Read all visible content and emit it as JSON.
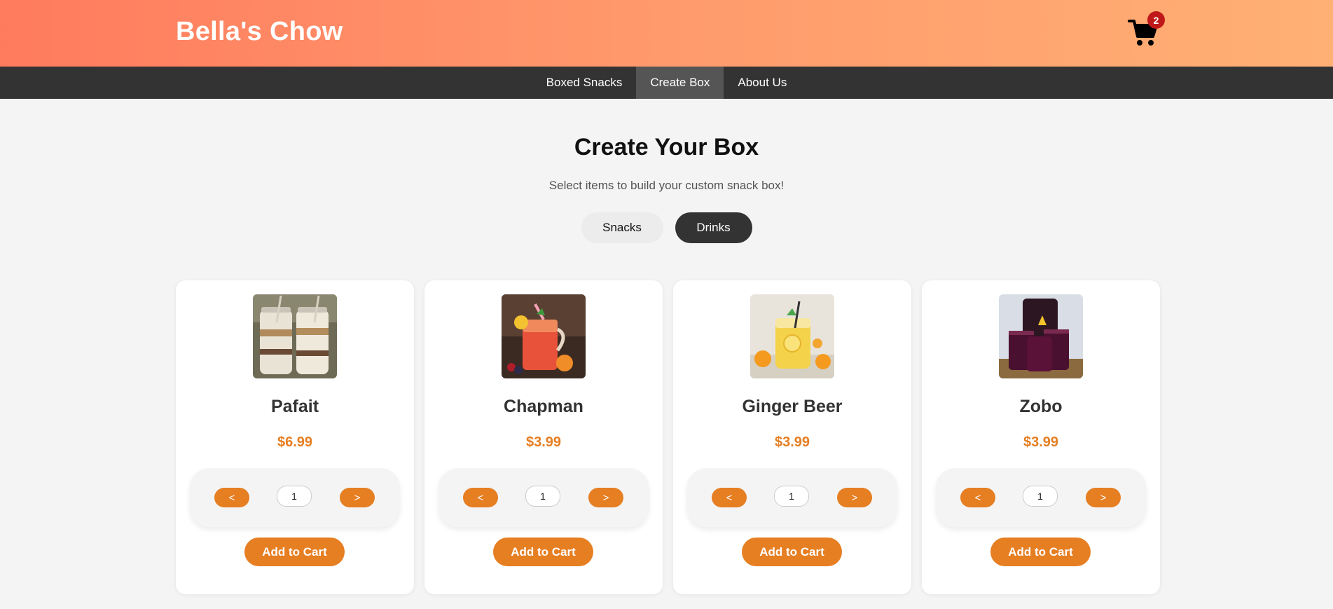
{
  "header": {
    "brand": "Bella's Chow",
    "cart_count": "2",
    "cart_icon": "shopping-cart-icon"
  },
  "nav": {
    "items": [
      {
        "label": "Boxed Snacks",
        "active": false
      },
      {
        "label": "Create Box",
        "active": true
      },
      {
        "label": "About Us",
        "active": false
      }
    ]
  },
  "main": {
    "title": "Create Your Box",
    "subtitle": "Select items to build your custom snack box!",
    "toggles": {
      "snacks": "Snacks",
      "drinks": "Drinks",
      "active": "Drinks"
    },
    "items": [
      {
        "name": "Pafait",
        "price": "$6.99",
        "qty": "1",
        "dec_label": "<",
        "inc_label": ">",
        "add_label": "Add to Cart"
      },
      {
        "name": "Chapman",
        "price": "$3.99",
        "qty": "1",
        "dec_label": "<",
        "inc_label": ">",
        "add_label": "Add to Cart"
      },
      {
        "name": "Ginger Beer",
        "price": "$3.99",
        "qty": "1",
        "dec_label": "<",
        "inc_label": ">",
        "add_label": "Add to Cart"
      },
      {
        "name": "Zobo",
        "price": "$3.99",
        "qty": "1",
        "dec_label": "<",
        "inc_label": ">",
        "add_label": "Add to Cart"
      }
    ]
  },
  "colors": {
    "accent": "#e67e22",
    "nav_bg": "#333333",
    "badge": "#c01818",
    "header_start": "#ff7b5e",
    "header_end": "#ffb074"
  }
}
